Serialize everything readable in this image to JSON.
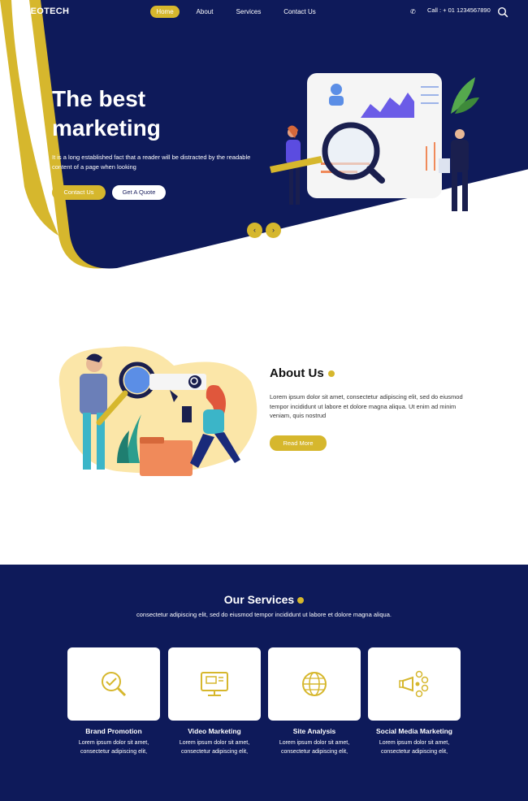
{
  "colors": {
    "navy": "#0e1a5a",
    "gold": "#d6b72d",
    "white": "#ffffff"
  },
  "nav": {
    "logo": "SEOTECH",
    "items": [
      {
        "label": "Home",
        "active": true
      },
      {
        "label": "About",
        "active": false
      },
      {
        "label": "Services",
        "active": false
      },
      {
        "label": "Contact Us",
        "active": false
      }
    ],
    "phone_icon": "phone-icon",
    "call": "Call : + 01 1234567890",
    "search_icon": "search-icon"
  },
  "hero": {
    "title_line1": "The best",
    "title_line2": "marketing",
    "text": "It is a long established fact that a reader will be distracted by the readable content of a page when looking",
    "contact_button": "Contact Us",
    "quote_button": "Get A Quote",
    "prev_icon": "chevron-left-icon",
    "next_icon": "chevron-right-icon"
  },
  "about": {
    "title": "About Us",
    "text": "Lorem ipsum dolor sit amet, consectetur adipiscing elit, sed do eiusmod tempor incididunt ut labore et dolore magna aliqua. Ut enim ad minim veniam, quis nostrud",
    "button": "Read More"
  },
  "services": {
    "title": "Our Services",
    "subtitle": "consectetur adipiscing elit, sed do eiusmod tempor incididunt ut labore et dolore magna aliqua.",
    "items": [
      {
        "title": "Brand Promotion",
        "desc1": "Lorem ipsum dolor sit amet,",
        "desc2": "consectetur adipiscing elit,",
        "icon": "magnifier-check-icon"
      },
      {
        "title": "Video Marketing",
        "desc1": "Lorem ipsum dolor sit amet,",
        "desc2": "consectetur adipiscing elit,",
        "icon": "monitor-icon"
      },
      {
        "title": "Site Analysis",
        "desc1": "Lorem ipsum dolor sit amet,",
        "desc2": "consectetur adipiscing elit,",
        "icon": "globe-icon"
      },
      {
        "title": "Social Media Marketing",
        "desc1": "Lorem ipsum dolor sit amet,",
        "desc2": "consectetur adipiscing elit,",
        "icon": "megaphone-icon"
      }
    ]
  }
}
